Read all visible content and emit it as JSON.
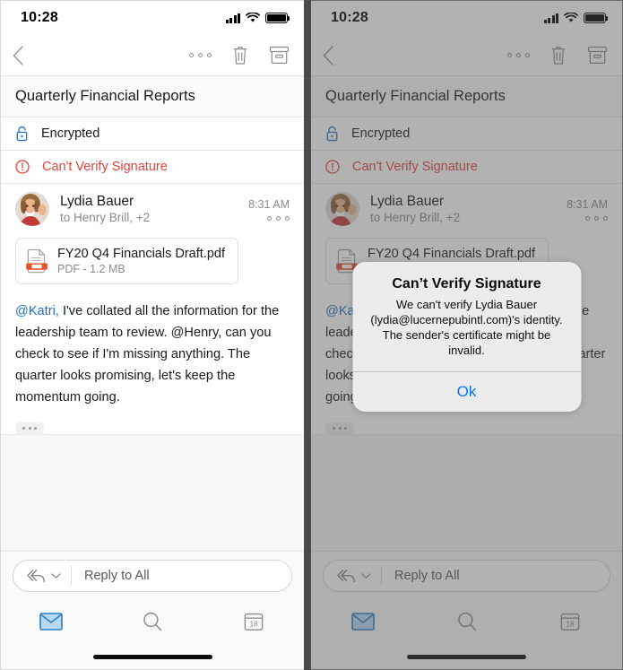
{
  "status_bar": {
    "time": "10:28",
    "signal_icon": "cellular-signal-icon",
    "wifi_icon": "wifi-icon",
    "battery_icon": "battery-full-icon"
  },
  "toolbar": {
    "back_icon": "chevron-left-icon",
    "more_icon": "more-horizontal-icon",
    "delete_icon": "trash-icon",
    "archive_icon": "archive-icon"
  },
  "message": {
    "subject": "Quarterly Financial Reports",
    "encrypted_label": "Encrypted",
    "encrypted_icon": "lock-icon",
    "signature_label": "Can't Verify Signature",
    "signature_icon": "exclamation-circle-icon",
    "sender_name": "Lydia Bauer",
    "recipients": "to Henry Brill, +2",
    "time": "8:31 AM",
    "avatar_icon": "avatar-photo",
    "thread_more_icon": "more-horizontal-icon",
    "attachment": {
      "icon": "pdf-file-icon",
      "name": "FY20 Q4 Financials Draft.pdf",
      "meta": "PDF - 1.2 MB"
    },
    "body": {
      "mention": "@Katri,",
      "rest": " I've collated all the information for the leadership team to review. @Henry, can you check to see if I'm missing anything. The quarter looks promising, let's keep the momentum going."
    },
    "expand_icon": "ellipsis-expand-icon"
  },
  "reply_bar": {
    "reply_all_icon": "reply-all-icon",
    "chevron_icon": "chevron-down-icon",
    "placeholder": "Reply to All"
  },
  "tab_bar": {
    "tabs": [
      {
        "name": "mail",
        "icon": "envelope-icon",
        "active": true
      },
      {
        "name": "search",
        "icon": "magnifier-icon",
        "active": false
      },
      {
        "name": "calendar",
        "icon": "calendar-icon",
        "active": false,
        "day": "18"
      }
    ]
  },
  "dialog": {
    "title": "Can’t Verify Signature",
    "message": "We can't verify Lydia Bauer (lydia@lucernepubintl.com)'s identity. The sender's certificate might be invalid.",
    "ok_label": "Ok"
  },
  "colors": {
    "accent_blue": "#0a74f0",
    "mention_blue": "#1573c4",
    "lock_blue": "#2e7cc4",
    "error_red": "#e2433a",
    "pdf_red": "#e8502a"
  }
}
